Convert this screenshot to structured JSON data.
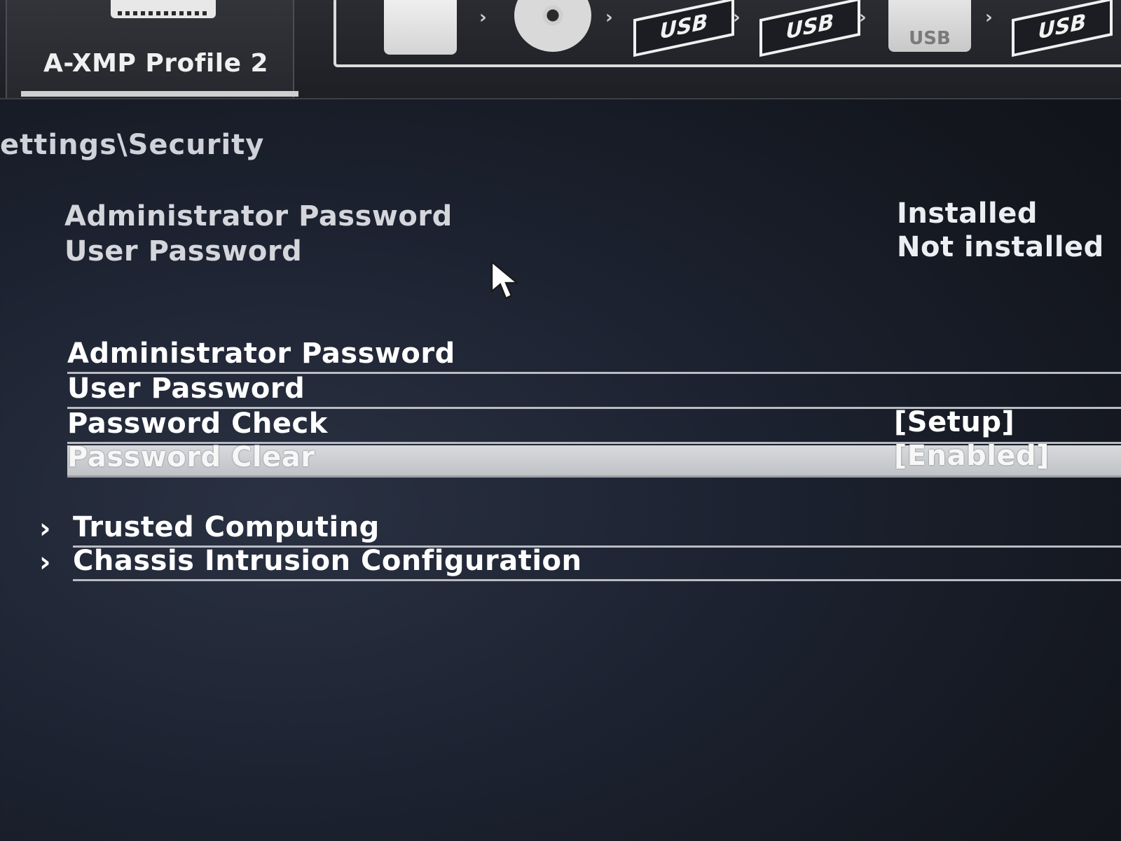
{
  "header": {
    "xmp_profile_label": "A-XMP Profile 2",
    "boot_devices": [
      {
        "icon": "hdd-icon",
        "label": ""
      },
      {
        "icon": "optical-disc-icon",
        "label": ""
      },
      {
        "icon": "usb-drive-icon",
        "label": "USB"
      },
      {
        "icon": "usb-optical-icon",
        "label": "USB"
      },
      {
        "icon": "usb-stick-icon",
        "label": "USB"
      },
      {
        "icon": "usb-drive-icon",
        "label": "USB"
      }
    ]
  },
  "breadcrumb": "ettings\\Security",
  "status": [
    {
      "label": "Administrator Password",
      "value": "Installed"
    },
    {
      "label": "User Password",
      "value": "Not installed"
    }
  ],
  "settings": [
    {
      "label": "Administrator Password",
      "value": ""
    },
    {
      "label": "User Password",
      "value": ""
    },
    {
      "label": "Password Check",
      "value": "[Setup]"
    },
    {
      "label": "Password Clear",
      "value": "[Enabled]",
      "selected": true
    }
  ],
  "submenus": [
    {
      "label": "Trusted Computing"
    },
    {
      "label": "Chassis Intrusion Configuration"
    }
  ]
}
